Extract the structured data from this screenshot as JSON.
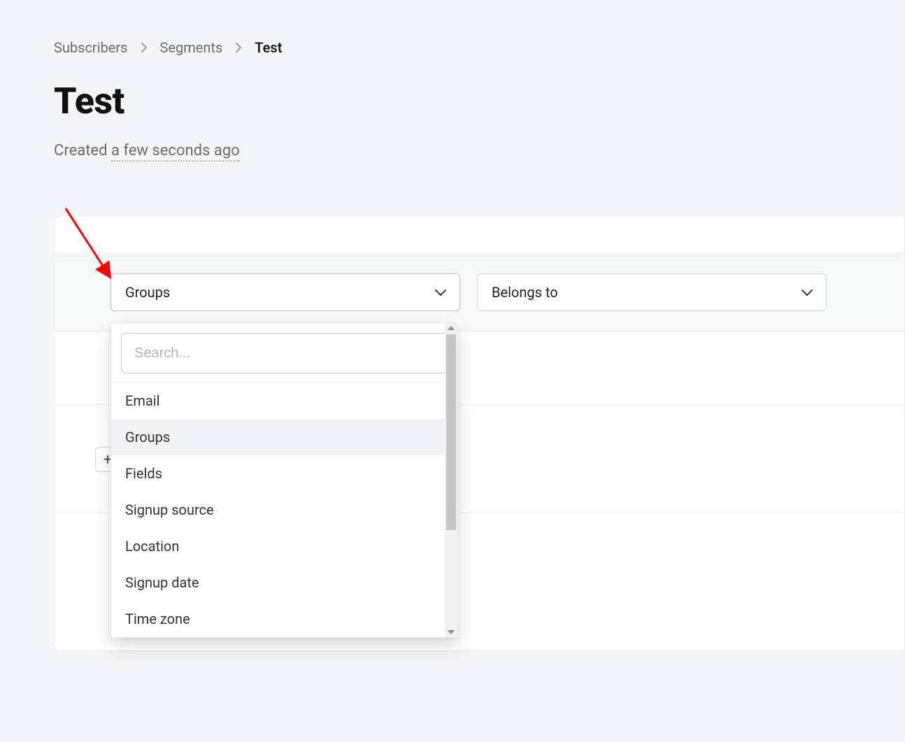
{
  "breadcrumb": {
    "items": [
      {
        "label": "Subscribers"
      },
      {
        "label": "Segments"
      },
      {
        "label": "Test"
      }
    ]
  },
  "page": {
    "title": "Test",
    "created_prefix": "Created ",
    "created_time": "a few seconds ago"
  },
  "filter": {
    "field_select": {
      "value": "Groups"
    },
    "operator_select": {
      "value": "Belongs to"
    },
    "dropdown": {
      "search_placeholder": "Search...",
      "options": [
        {
          "label": "Email"
        },
        {
          "label": "Groups",
          "active": true
        },
        {
          "label": "Fields"
        },
        {
          "label": "Signup source"
        },
        {
          "label": "Location"
        },
        {
          "label": "Signup date"
        },
        {
          "label": "Time zone"
        }
      ]
    },
    "add_label": "+"
  }
}
